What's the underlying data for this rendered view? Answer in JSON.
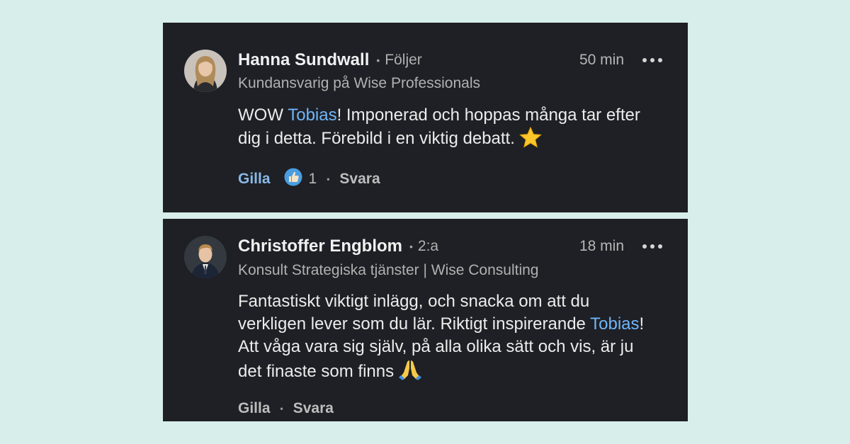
{
  "comments": [
    {
      "name": "Hanna Sundwall",
      "connection": "Följer",
      "time": "50 min",
      "headline": "Kundansvarig på Wise Professionals",
      "text_before": "WOW ",
      "mention": "Tobias",
      "text_after": "! Imponerad och hoppas många tar efter dig i detta. Förebild i en viktig debatt.",
      "emoji": "star-icon",
      "like_label": "Gilla",
      "reaction_icon": "like-reaction-icon",
      "reaction_count": "1",
      "reply_label": "Svara",
      "like_color": "#8ab9e8"
    },
    {
      "name": "Christoffer Engblom",
      "connection": "2:a",
      "time": "18 min",
      "headline": "Konsult Strategiska tjänster | Wise Consulting",
      "text_before": "Fantastiskt viktigt inlägg, och snacka om att du verkligen lever som du lär. Riktigt inspirerande ",
      "mention": "Tobias",
      "text_after": "! Att våga vara sig själv, på alla olika sätt och vis, är ju det finaste som finns",
      "emoji": "praying-hands-icon",
      "like_label": "Gilla",
      "reply_label": "Svara"
    }
  ],
  "colors": {
    "background": "#d8eeeb",
    "card": "#1e2025",
    "mention": "#70b5f9",
    "like_active": "#8ab9e8"
  }
}
